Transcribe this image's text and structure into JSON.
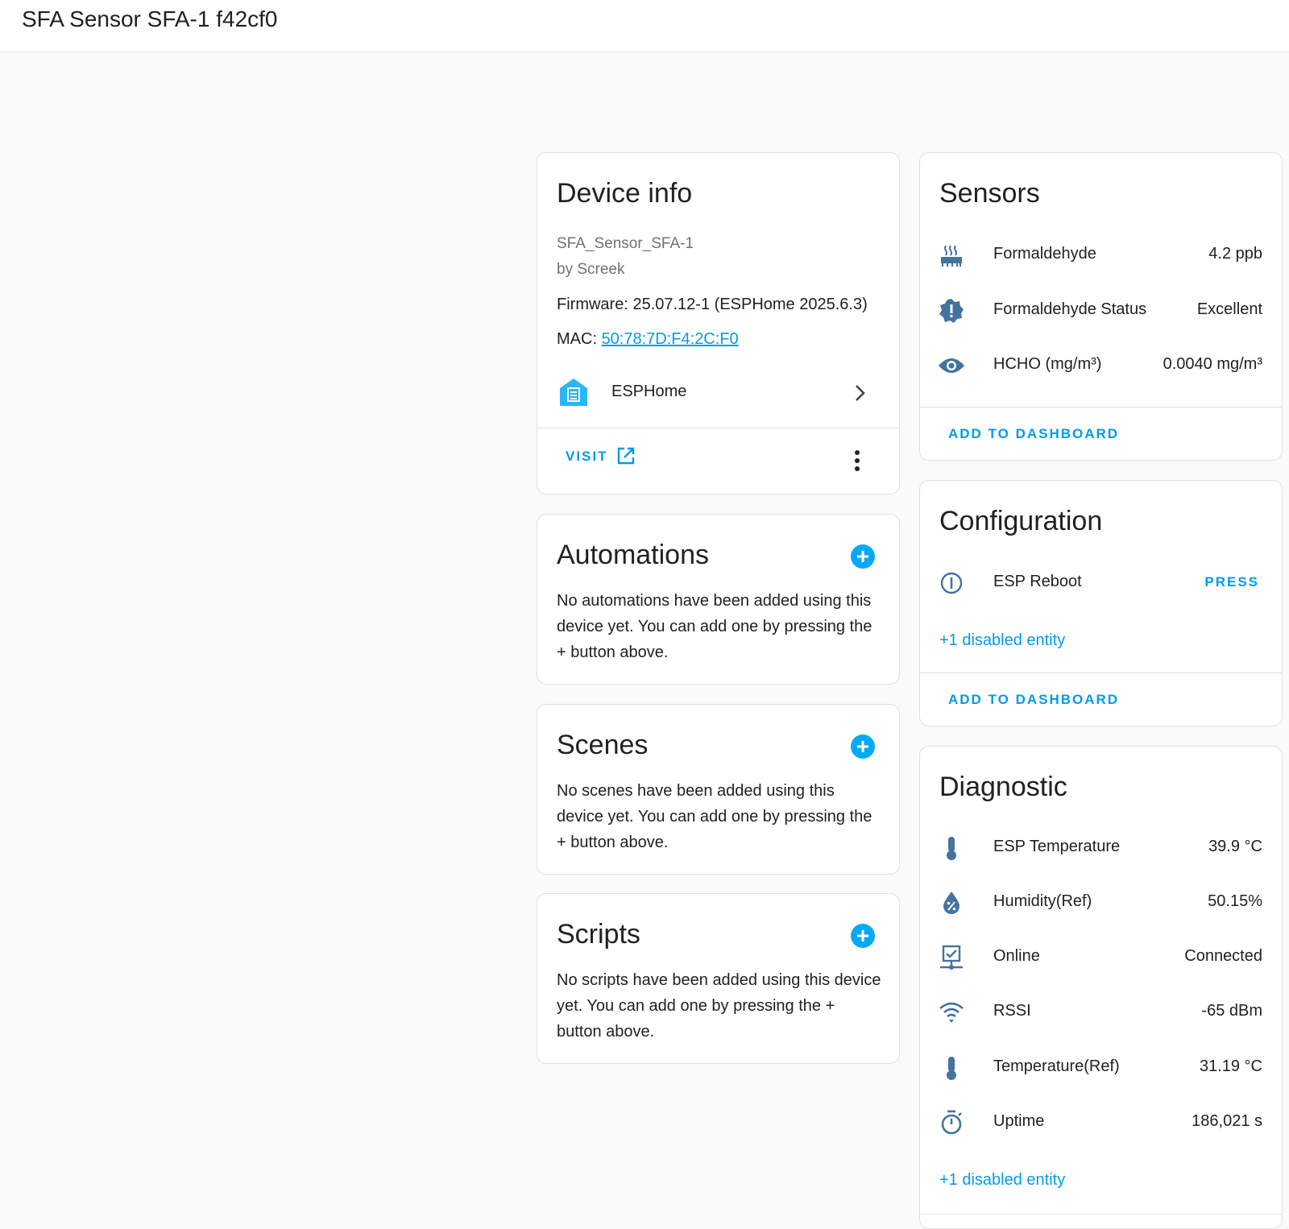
{
  "page": {
    "title": "SFA Sensor SFA-1 f42cf0"
  },
  "colors": {
    "accent": "#03a9f4",
    "link": "#039be5",
    "icon": "#44739e"
  },
  "device_info": {
    "title": "Device info",
    "model": "SFA_Sensor_SFA-1",
    "manufacturer": "by Screek",
    "firmware": "Firmware: 25.07.12-1 (ESPHome 2025.6.3)",
    "mac_label": "MAC: ",
    "mac_value": "50:78:7D:F4:2C:F0",
    "integration": {
      "name": "ESPHome",
      "icon": "esphome-house-icon"
    },
    "visit_label": "VISIT"
  },
  "automations": {
    "title": "Automations",
    "text": "No automations have been added using this device yet. You can add one by pressing the + button above."
  },
  "scenes": {
    "title": "Scenes",
    "text": "No scenes have been added using this device yet. You can add one by pressing the + button above."
  },
  "scripts": {
    "title": "Scripts",
    "text": "No scripts have been added using this device yet. You can add one by pressing the + button above."
  },
  "sensors": {
    "title": "Sensors",
    "items": [
      {
        "icon": "radiator-icon",
        "label": "Formaldehyde",
        "value": "4.2 ppb"
      },
      {
        "icon": "alert-decagram-icon",
        "label": "Formaldehyde Status",
        "value": "Excellent"
      },
      {
        "icon": "eye-icon",
        "label": "HCHO (mg/m³)",
        "value": "0.0040 mg/m³"
      }
    ],
    "add_to_dashboard": "ADD TO DASHBOARD"
  },
  "configuration": {
    "title": "Configuration",
    "items": [
      {
        "icon": "power-icon",
        "label": "ESP Reboot",
        "action": "PRESS"
      }
    ],
    "disabled_link": "+1 disabled entity",
    "add_to_dashboard": "ADD TO DASHBOARD"
  },
  "diagnostic": {
    "title": "Diagnostic",
    "items": [
      {
        "icon": "thermometer-icon",
        "label": "ESP Temperature",
        "value": "39.9 °C"
      },
      {
        "icon": "water-percent-icon",
        "label": "Humidity(Ref)",
        "value": "50.15%"
      },
      {
        "icon": "network-check-icon",
        "label": "Online",
        "value": "Connected"
      },
      {
        "icon": "wifi-icon",
        "label": "RSSI",
        "value": "-65 dBm"
      },
      {
        "icon": "thermometer-icon",
        "label": "Temperature(Ref)",
        "value": "31.19 °C"
      },
      {
        "icon": "timer-icon",
        "label": "Uptime",
        "value": "186,021 s"
      }
    ],
    "disabled_link": "+1 disabled entity"
  }
}
